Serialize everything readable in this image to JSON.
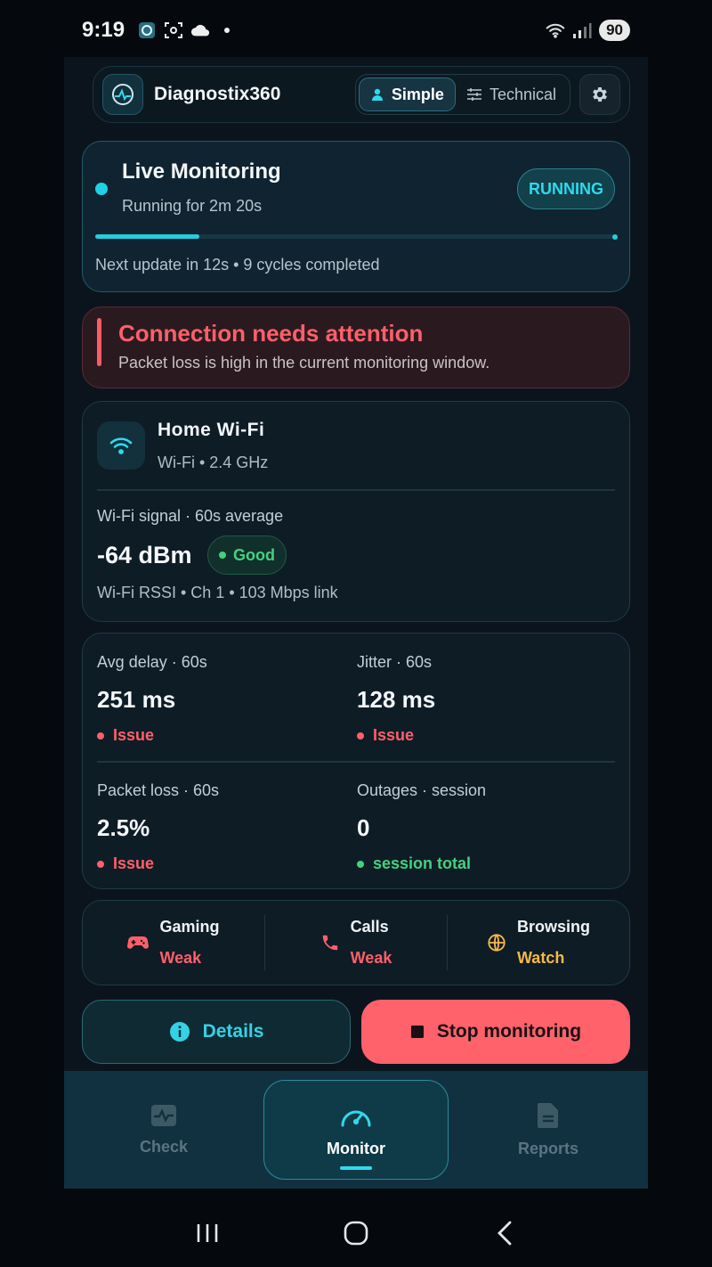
{
  "status_bar": {
    "time": "9:19",
    "battery": "90"
  },
  "header": {
    "app_name": "Diagnostix360",
    "mode_simple": "Simple",
    "mode_technical": "Technical"
  },
  "live": {
    "title": "Live Monitoring",
    "subtitle": "Running for 2m 20s",
    "badge": "RUNNING",
    "progress": 0.2,
    "footer": "Next update in 12s • 9 cycles completed"
  },
  "alert": {
    "title": "Connection needs attention",
    "message": "Packet loss is high in the current monitoring window."
  },
  "wifi": {
    "name": "Home Wi-Fi",
    "sub": "Wi-Fi • 2.4 GHz",
    "signal_label": "Wi-Fi signal · 60s average",
    "signal_value": "-64 dBm",
    "signal_status": "Good",
    "signal_detail": "Wi-Fi RSSI • Ch 1 • 103 Mbps link"
  },
  "metrics": [
    {
      "label": "Avg delay · 60s",
      "value": "251 ms",
      "status": "Issue"
    },
    {
      "label": "Jitter · 60s",
      "value": "128 ms",
      "status": "Issue"
    },
    {
      "label": "Packet loss · 60s",
      "value": "2.5%",
      "status": "Issue"
    },
    {
      "label": "Outages · session",
      "value": "0",
      "status": "session total"
    }
  ],
  "use_cases": [
    {
      "title": "Gaming",
      "status": "Weak",
      "color": "#ff5f69"
    },
    {
      "title": "Calls",
      "status": "Weak",
      "color": "#ff5f69"
    },
    {
      "title": "Browsing",
      "status": "Watch",
      "color": "#f5b84a"
    }
  ],
  "buttons": {
    "details": "Details",
    "stop": "Stop monitoring"
  },
  "nav": {
    "check": "Check",
    "monitor": "Monitor",
    "reports": "Reports"
  },
  "colors": {
    "accent": "#2fd9ec",
    "issue": "#ff5f69",
    "good": "#43d17e",
    "watch": "#f5b84a"
  }
}
